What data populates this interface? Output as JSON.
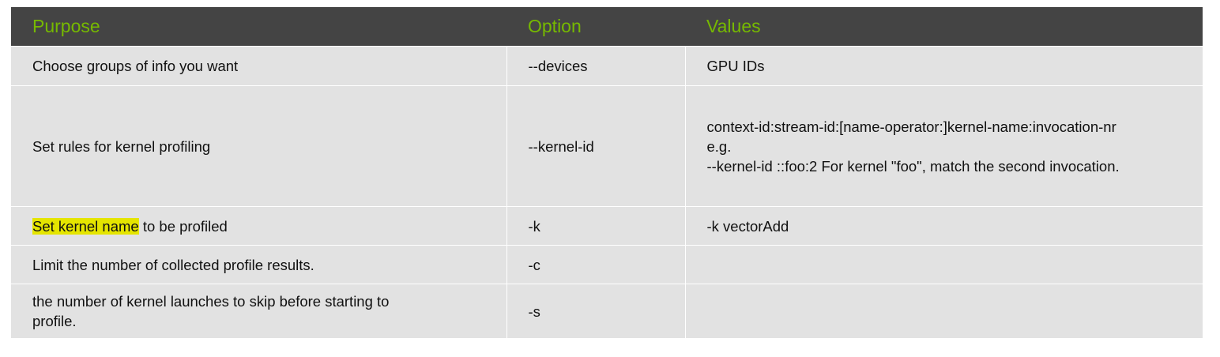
{
  "header": {
    "purpose": "Purpose",
    "option": "Option",
    "values": "Values"
  },
  "rows": [
    {
      "purpose": "Choose groups of info you want",
      "option": "--devices",
      "value": "GPU IDs"
    },
    {
      "purpose": "Set rules for kernel profiling",
      "option": "--kernel-id",
      "value_lines": [
        "context-id:stream-id:[name-operator:]kernel-name:invocation-nr",
        "e.g.",
        "--kernel-id ::foo:2 For kernel \"foo\", match the second invocation."
      ]
    },
    {
      "purpose_highlight": "Set kernel name",
      "purpose_rest": " to be profiled",
      "option": "-k",
      "value": "-k vectorAdd"
    },
    {
      "purpose": "Limit the number of collected profile results.",
      "option": "-c",
      "value": ""
    },
    {
      "purpose_lines": [
        "the number of kernel launches to skip before starting to",
        "profile."
      ],
      "option": "-s",
      "value": ""
    }
  ],
  "colors": {
    "header_bg": "#444444",
    "header_text": "#76b900",
    "row_bg": "#e2e2e2",
    "highlight": "#e5e500"
  }
}
